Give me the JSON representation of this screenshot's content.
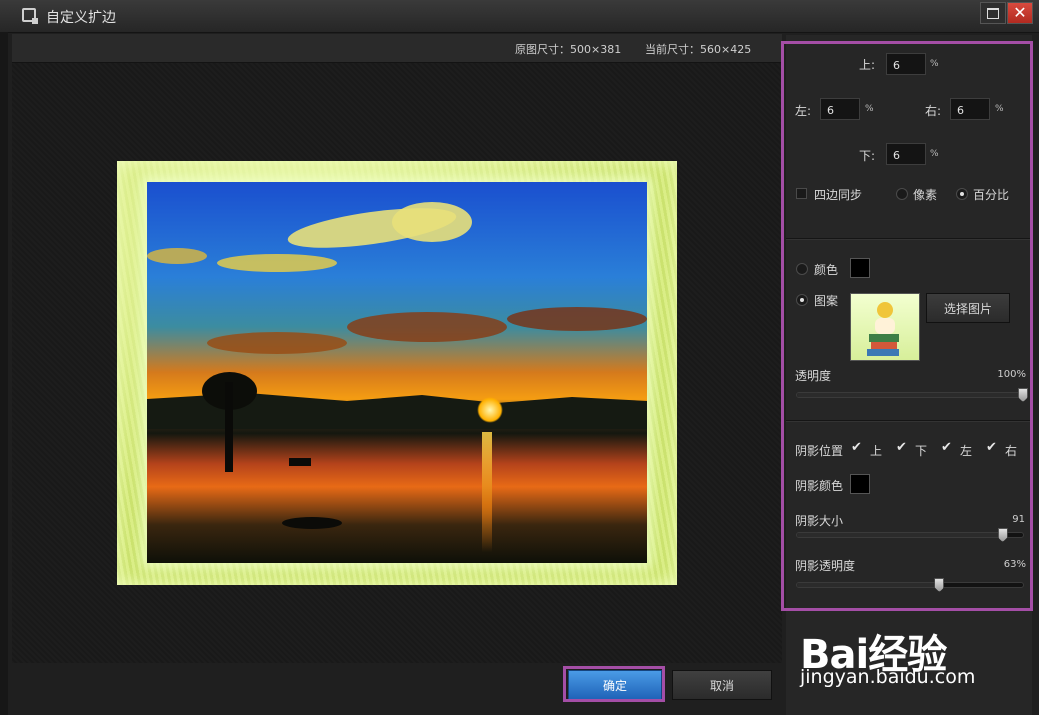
{
  "window": {
    "title": "自定义扩边",
    "maximize_icon": "maximize-icon",
    "close_glyph": "✕"
  },
  "infobar": {
    "original_size": "原图尺寸：500×381",
    "current_size": "当前尺寸：560×425"
  },
  "margins": {
    "top_label": "上:",
    "top_value": "6",
    "left_label": "左:",
    "left_value": "6",
    "right_label": "右:",
    "right_value": "6",
    "bottom_label": "下:",
    "bottom_value": "6",
    "unit": "%"
  },
  "options": {
    "sync_label": "四边同步",
    "sync_checked": false,
    "pixel_label": "像素",
    "pixel_selected": false,
    "percent_label": "百分比",
    "percent_selected": true
  },
  "fill": {
    "color_label": "颜色",
    "color_selected": false,
    "color_value": "#000000",
    "pattern_label": "图案",
    "pattern_selected": true,
    "choose_image_label": "选择图片",
    "opacity_label": "透明度",
    "opacity_value": "100%",
    "opacity_fraction": 1.0
  },
  "shadow": {
    "position_label": "阴影位置",
    "positions": [
      {
        "label": "上",
        "checked": true
      },
      {
        "label": "下",
        "checked": true
      },
      {
        "label": "左",
        "checked": true
      },
      {
        "label": "右",
        "checked": true
      }
    ],
    "color_label": "阴影颜色",
    "color_value": "#000000",
    "size_label": "阴影大小",
    "size_value": "91",
    "size_fraction": 0.91,
    "opacity_label": "阴影透明度",
    "opacity_value": "63%",
    "opacity_fraction": 0.63
  },
  "buttons": {
    "ok": "确定",
    "cancel": "取消"
  },
  "watermark": {
    "logo": "Bai经验",
    "url": "jingyan.baidu.com"
  },
  "colors": {
    "highlight": "#a44ea6",
    "ok_button": "#2f7fd4",
    "frame_pattern": "#d7ec7e"
  }
}
